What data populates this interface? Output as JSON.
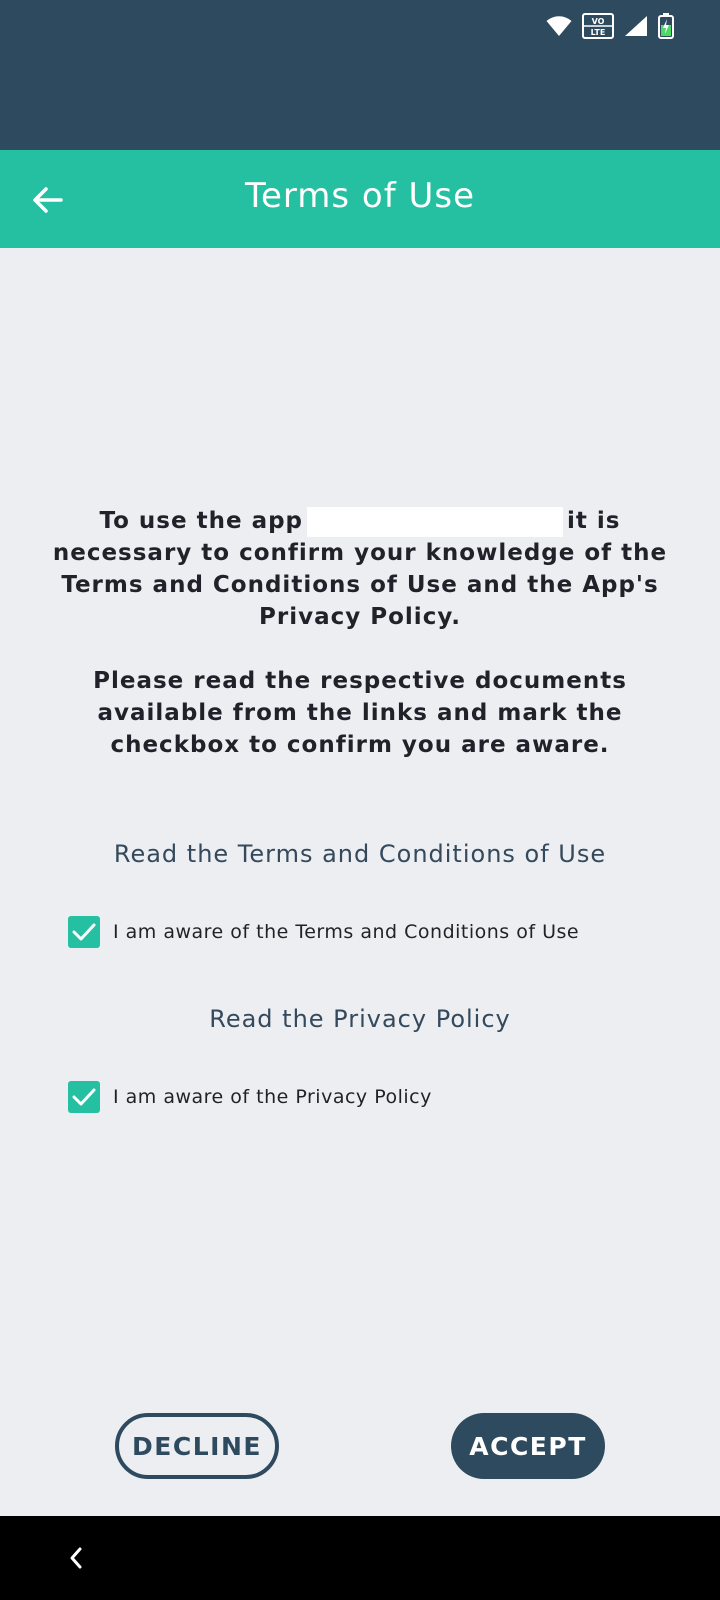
{
  "status_bar": {
    "icons": [
      "wifi-icon",
      "volte-icon",
      "signal-icon",
      "battery-charging-icon"
    ],
    "volte_top": "VO",
    "volte_bottom": "LTE"
  },
  "app_bar": {
    "title": "Terms of Use",
    "back_icon": "arrow-left-icon"
  },
  "intro": {
    "paragraph1_before": "To use the app",
    "paragraph1_after": "it is necessary to confirm your knowledge of the Terms and Conditions of Use and the App's Privacy Policy.",
    "paragraph2": "Please read the respective documents available from the links and mark the checkbox to confirm you are aware."
  },
  "terms": {
    "link_label": "Read the Terms and Conditions of Use",
    "checkbox_label": "I am aware of the Terms and Conditions of Use",
    "checked": true
  },
  "privacy": {
    "link_label": "Read the Privacy Policy",
    "checkbox_label": "I am aware of the Privacy Policy",
    "checked": true
  },
  "buttons": {
    "decline": "DECLINE",
    "accept": "ACCEPT"
  },
  "nav_bar": {
    "back_icon": "chevron-left-icon"
  },
  "colors": {
    "status_bar": "#2e4a5e",
    "accent": "#25c0a2",
    "primary_dark": "#2e4a5e",
    "background": "#eceef2"
  }
}
